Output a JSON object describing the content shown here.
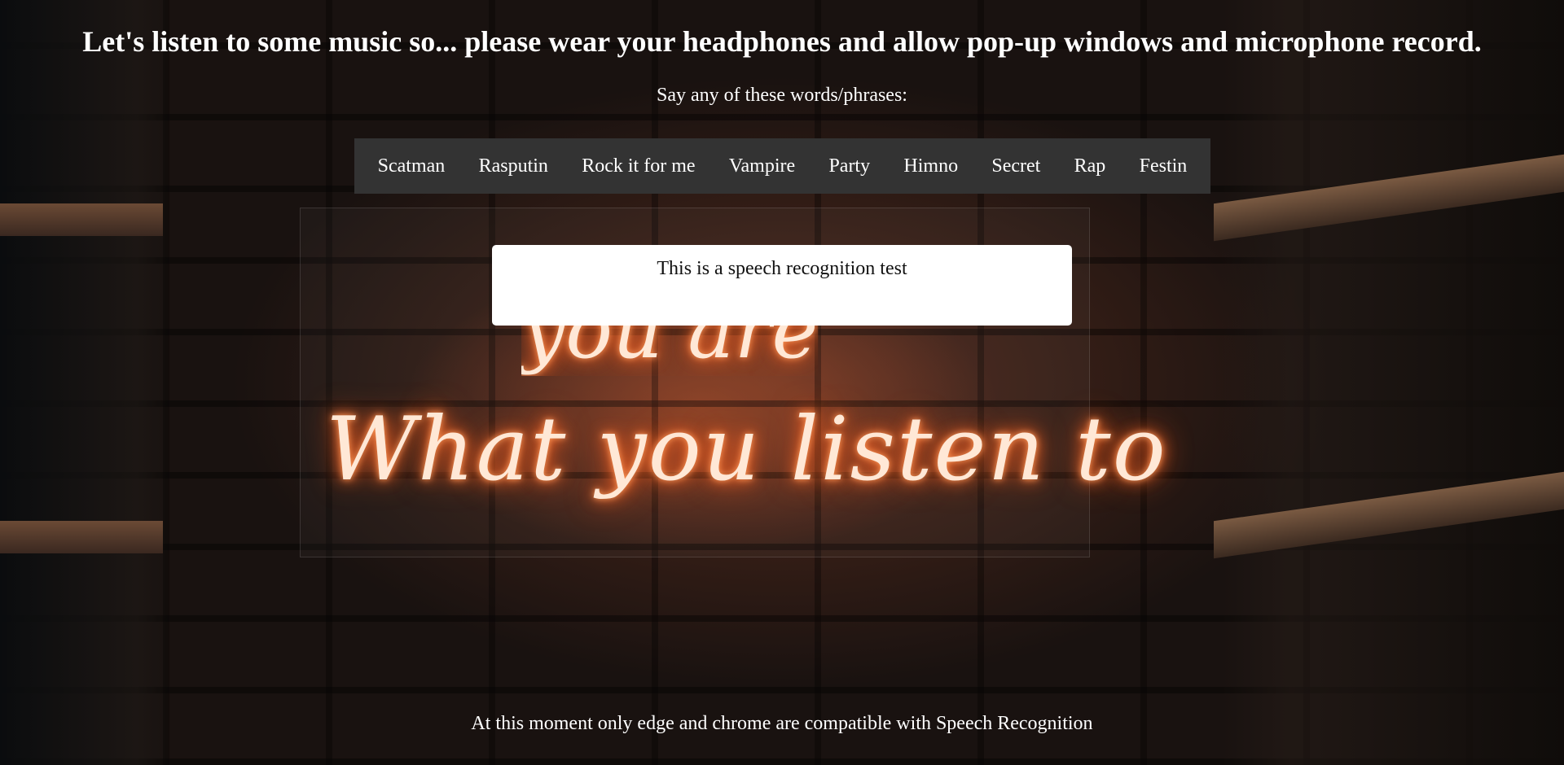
{
  "header": {
    "title": "Let's listen to some music so... please wear your headphones and allow pop-up windows and microphone record."
  },
  "instructions": {
    "text": "Say any of these words/phrases:"
  },
  "phrases": [
    {
      "label": "Scatman"
    },
    {
      "label": "Rasputin"
    },
    {
      "label": "Rock it for me"
    },
    {
      "label": "Vampire"
    },
    {
      "label": "Party"
    },
    {
      "label": "Himno"
    },
    {
      "label": "Secret"
    },
    {
      "label": "Rap"
    },
    {
      "label": "Festin"
    }
  ],
  "result": {
    "text": "This is a speech recognition test"
  },
  "footer": {
    "text": "At this moment only edge and chrome are compatible with Speech Recognition"
  },
  "background": {
    "neon_line_1": "you are",
    "neon_line_2": "What you listen to"
  },
  "colors": {
    "phrase_bar": "#333333",
    "result_box": "#ffffff",
    "text": "#ffffff",
    "neon_glow": "#ff6a2a"
  }
}
